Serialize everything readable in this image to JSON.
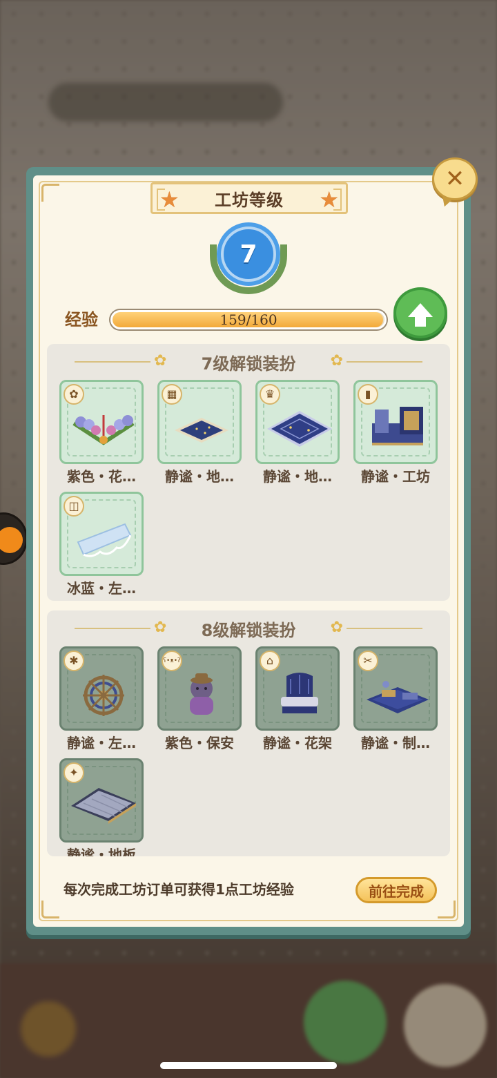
{
  "dialog": {
    "title": "工坊等级",
    "level": "7",
    "exp_label": "经验",
    "exp_text": "159/160",
    "exp_progress": 0.99375,
    "close_icon": "close-icon",
    "upgrade_icon": "arrow-up-icon"
  },
  "sections": [
    {
      "title": "7级解锁装扮",
      "items": [
        {
          "label": "紫色・花…",
          "tag_icon": "flower-bed-icon",
          "tag_glyph": "✿"
        },
        {
          "label": "静谧・地…",
          "tag_icon": "rug-icon",
          "tag_glyph": "▦"
        },
        {
          "label": "静谧・地…",
          "tag_icon": "crown-rug-icon",
          "tag_glyph": "♛"
        },
        {
          "label": "静谧・工坊",
          "tag_icon": "paint-roller-icon",
          "tag_glyph": "▮"
        },
        {
          "label": "冰蓝・左…",
          "tag_icon": "curtain-icon",
          "tag_glyph": "◫"
        }
      ]
    },
    {
      "title": "8级解锁装扮",
      "items": [
        {
          "label": "静谧・左…",
          "tag_icon": "wall-decor-icon",
          "tag_glyph": "✱"
        },
        {
          "label": "紫色・保安",
          "tag_icon": "teddy-bear-icon",
          "tag_glyph": "ʕ•ᴥ•ʔ"
        },
        {
          "label": "静谧・花架",
          "tag_icon": "chair-icon",
          "tag_glyph": "⌂"
        },
        {
          "label": "静谧・制…",
          "tag_icon": "scissors-icon",
          "tag_glyph": "✂"
        },
        {
          "label": "静谧・地板",
          "tag_icon": "floor-icon",
          "tag_glyph": "✦"
        }
      ]
    }
  ],
  "footer": {
    "hint": "每次完成工坊订单可获得1点工坊经验",
    "go_button": "前往完成"
  },
  "colors": {
    "panel_frame": "#5f8f88",
    "panel_bg": "#fbf6e8",
    "card_green": "#d5ead9",
    "card_dark": "#8fa292",
    "exp_fill": "#f2a93a",
    "upgrade_green": "#5fbc56",
    "level_blue": "#3a8fe0"
  }
}
